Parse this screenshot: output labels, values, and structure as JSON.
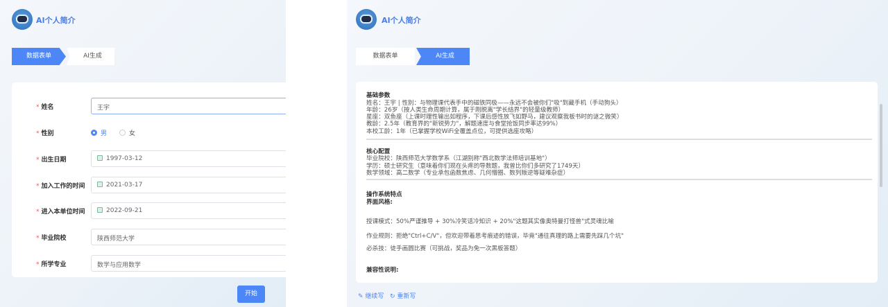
{
  "app": {
    "title": "AI个人简介"
  },
  "tabs": [
    {
      "label": "数据表单"
    },
    {
      "label": "AI生成"
    }
  ],
  "form": {
    "name": {
      "label": "姓名",
      "value": "王宇"
    },
    "gender": {
      "label": "性别",
      "options": [
        "男",
        "女"
      ],
      "selected": "男"
    },
    "birth": {
      "label": "出生日期",
      "value": "1997-03-12"
    },
    "work_start": {
      "label": "加入工作的时间",
      "value": "2021-03-17"
    },
    "unit_start": {
      "label": "进入本单位时间",
      "value": "2022-09-21"
    },
    "school": {
      "label": "毕业院校",
      "value": "陕西师范大学"
    },
    "major": {
      "label": "所学专业",
      "value": "数学与应用数学"
    },
    "start_button": "开始"
  },
  "result": {
    "s1_title": "基础参数",
    "s1": [
      "姓名：王宇 | 性别：与物理课代表手中的磁铁同极——永远不会被你们\"吸\"到藏手机（手动狗头）",
      "年龄：26岁（按人类生命周期计算，属于刚脱离\"学长结界\"的轻量级教师）",
      "星座：双鱼座（上课时理性输出如程序，下课后感性放飞如野马，建议观察我板书时的谜之微笑）",
      "教龄：2.5年（教育界的\"新锐势力\"，解题速度与食堂抢饭同步率达99%）",
      "本校工龄：1年（已掌握学校WiFi全覆盖点位，可提供选座攻略）"
    ],
    "s2_title": "核心配置",
    "s2": [
      "毕业院校：陕西师范大学数学系（江湖别称\"西北数学法师培训基地\"）",
      "学历：硕士研究生（意味着你们现在头疼的导数题，我曾比你们多研究了1749天）",
      "数学领域：高二数学（专业承包函数焦虑、几何懵圈、数列叛逆等疑难杂症）"
    ],
    "s3_title": "操作系统特点",
    "s3_sub": "界面风格:",
    "s3": [
      "授课模式：50%严谨推导 + 30%冷笑话冷知识 + 20%\"这题其实像奥特曼打怪兽\"式灵魂比喻",
      "作业规则：拒绝\"Ctrl+C/V\"，但欢迎带着思考痕迹的错误，毕竟\"通往真理的路上需要先踩几个坑\"",
      "必杀技：徒手画圆比赛（可挑战，奖品为免一次黑板答题）"
    ],
    "s4_title": "兼容性说明:"
  },
  "actions": {
    "continue": "继续写",
    "rewrite": "重新写"
  },
  "colors": {
    "accent": "#4d86f7"
  }
}
